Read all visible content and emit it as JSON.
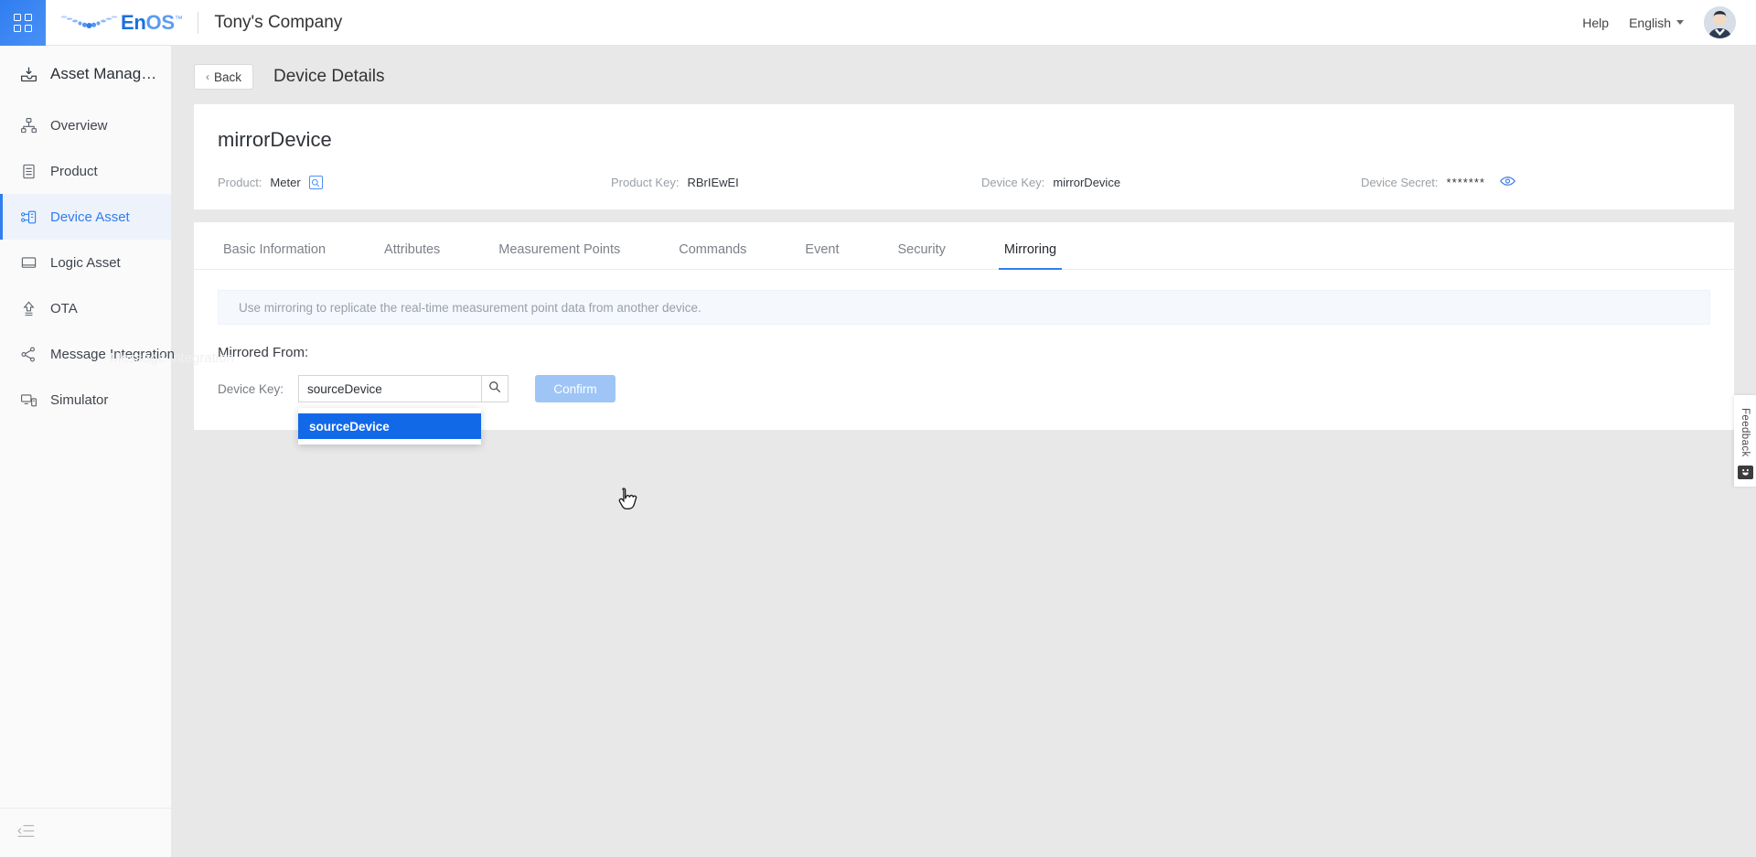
{
  "topbar": {
    "launcher_icon": "grid-apps-icon",
    "brand": {
      "en": "En",
      "os": "OS",
      "tm": "™"
    },
    "org_name": "Tony's Company",
    "help_label": "Help",
    "language_label": "English",
    "avatar_icon": "user-avatar"
  },
  "sidebar": {
    "header": {
      "label": "Asset Manag…",
      "icon": "asset-management-icon"
    },
    "items": [
      {
        "label": "Overview",
        "icon": "overview-hierarchy-icon",
        "active": false
      },
      {
        "label": "Product",
        "icon": "product-document-icon",
        "active": false
      },
      {
        "label": "Device Asset",
        "icon": "device-asset-icon",
        "active": true
      },
      {
        "label": "Logic Asset",
        "icon": "logic-asset-icon",
        "active": false
      },
      {
        "label": "OTA",
        "icon": "ota-upload-icon",
        "active": false
      },
      {
        "label": "Message Integration",
        "icon": "message-integration-icon",
        "active": false
      },
      {
        "label": "Simulator",
        "icon": "simulator-icon",
        "active": false
      }
    ],
    "ghost_watermark": "Message Integration",
    "collapse_icon": "collapse-sidebar-icon"
  },
  "page": {
    "back_label": "Back",
    "back_chevron": "‹",
    "title": "Device Details"
  },
  "device": {
    "name": "mirrorDevice",
    "meta": [
      {
        "label": "Product:",
        "value": "Meter",
        "has_link_icon": true,
        "link_icon": "product-detail-icon"
      },
      {
        "label": "Product Key:",
        "value": "RBrIEwEI",
        "has_link_icon": false
      },
      {
        "label": "Device Key:",
        "value": "mirrorDevice",
        "has_link_icon": false
      },
      {
        "label": "Device Secret:",
        "value": "*******",
        "has_eye_icon": true,
        "eye_icon": "eye-reveal-icon"
      }
    ]
  },
  "tabs": [
    {
      "label": "Basic Information",
      "active": false
    },
    {
      "label": "Attributes",
      "active": false
    },
    {
      "label": "Measurement Points",
      "active": false
    },
    {
      "label": "Commands",
      "active": false
    },
    {
      "label": "Event",
      "active": false
    },
    {
      "label": "Security",
      "active": false
    },
    {
      "label": "Mirroring",
      "active": true
    }
  ],
  "mirroring": {
    "banner_text": "Use mirroring to replicate the real-time measurement point data from another device.",
    "section_label": "Mirrored From:",
    "device_key_label": "Device Key:",
    "device_key_value": "sourceDevice",
    "device_key_placeholder": "",
    "search_icon": "search-magnifier-icon",
    "confirm_label": "Confirm",
    "confirm_disabled": true,
    "dropdown_options": [
      {
        "label": "sourceDevice",
        "highlighted": true
      }
    ]
  },
  "feedback": {
    "label": "Feedback",
    "icon": "smiley-feedback-icon"
  },
  "colors": {
    "accent": "#2f7ef0",
    "dropdown_highlight": "#1269e8",
    "confirm_disabled": "#9ec5f6",
    "page_bg": "#e8e8e8",
    "sidebar_bg": "#fafafa",
    "active_nav_bg": "#eef2fb",
    "banner_bg": "#f5f8fd"
  }
}
